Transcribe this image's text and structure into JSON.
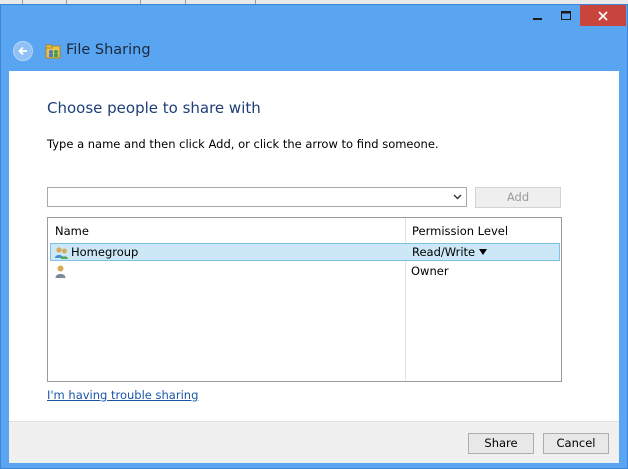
{
  "window": {
    "title": "File Sharing",
    "controls": {
      "minimize_icon": "minimize-icon",
      "maximize_icon": "maximize-icon",
      "close_icon": "close-icon"
    },
    "colors": {
      "frame": "#5aa5f2",
      "close_button": "#c7453c"
    }
  },
  "dialog": {
    "heading": "Choose people to share with",
    "instructions": "Type a name and then click Add, or click the arrow to find someone.",
    "name_input": {
      "value": "",
      "placeholder": ""
    },
    "add_button": {
      "label": "Add",
      "enabled": false
    },
    "list": {
      "columns": [
        "Name",
        "Permission Level"
      ],
      "rows": [
        {
          "name": "Homegroup",
          "permission": "Read/Write",
          "icon": "homegroup-icon",
          "selected": true
        },
        {
          "name": "",
          "permission": "Owner",
          "icon": "user-icon",
          "selected": false
        }
      ]
    },
    "trouble_link": "I'm having trouble sharing"
  },
  "footer": {
    "share_label": "Share",
    "cancel_label": "Cancel"
  }
}
